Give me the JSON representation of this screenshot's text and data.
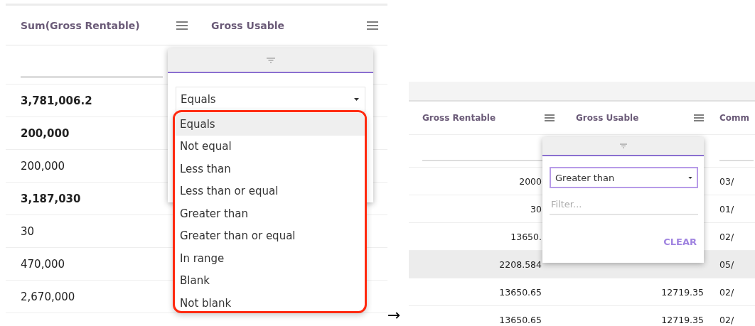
{
  "left": {
    "columns": [
      {
        "label": "Sum(Gross Rentable)"
      },
      {
        "label": "Gross Usable"
      }
    ],
    "rows": [
      {
        "value": "3,781,006.2",
        "bold": true
      },
      {
        "value": "200,000",
        "bold": true
      },
      {
        "value": "200,000",
        "bold": false
      },
      {
        "value": "3,187,030",
        "bold": true
      },
      {
        "value": "30",
        "bold": false
      },
      {
        "value": "470,000",
        "bold": false
      },
      {
        "value": "2,670,000",
        "bold": false
      }
    ],
    "filter_popup": {
      "operator": "Equals",
      "focused": false,
      "options": [
        {
          "label": "Equals",
          "selected": true
        },
        {
          "label": "Not equal",
          "selected": false
        },
        {
          "label": "Less than",
          "selected": false
        },
        {
          "label": "Less than or equal",
          "selected": false
        },
        {
          "label": "Greater than",
          "selected": false
        },
        {
          "label": "Greater than or equal",
          "selected": false
        },
        {
          "label": "In range",
          "selected": false
        },
        {
          "label": "Blank",
          "selected": false
        },
        {
          "label": "Not blank",
          "selected": false
        }
      ]
    }
  },
  "arrow": "→",
  "right": {
    "columns": [
      {
        "label": "Gross Rentable"
      },
      {
        "label": "Gross Usable"
      },
      {
        "label": "Comm"
      }
    ],
    "rows": [
      {
        "gross_rentable": "2000",
        "column_3": "03/",
        "hovered": false
      },
      {
        "gross_rentable": "30",
        "column_3": "01/",
        "hovered": false
      },
      {
        "gross_rentable": "13650.",
        "column_3": "02/",
        "hovered": false
      },
      {
        "gross_rentable": "2208.584",
        "column_3": "05/",
        "hovered": true
      },
      {
        "gross_rentable": "13650.65",
        "gross_usable": "12719.35",
        "column_3": "02/",
        "hovered": false
      },
      {
        "gross_rentable": "13650.65",
        "gross_usable": "12719.35",
        "column_3": "02/",
        "hovered": false
      }
    ],
    "filter_popup": {
      "operator": "Greater than",
      "focused": true,
      "placeholder": "Filter...",
      "clear": "CLEAR"
    }
  }
}
